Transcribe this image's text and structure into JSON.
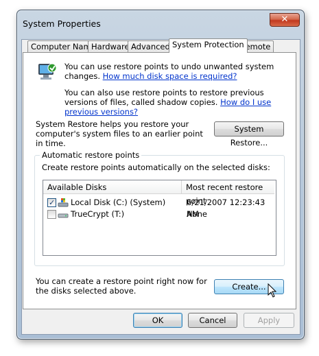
{
  "window": {
    "title": "System Properties",
    "close_glyph": "✕"
  },
  "tabs": [
    {
      "label": "Computer Name"
    },
    {
      "label": "Hardware"
    },
    {
      "label": "Advanced"
    },
    {
      "label": "System Protection"
    },
    {
      "label": "Remote"
    }
  ],
  "intro": {
    "line1": "You can use restore points to undo unwanted system changes.",
    "link1": "How much disk space is required?",
    "line2": "You can also use restore points to restore previous versions of files, called shadow copies.",
    "link2": "How do I use previous versions?"
  },
  "system_restore": {
    "description": "System Restore helps you restore your computer's system files to an earlier point in time.",
    "button_label": "System Restore..."
  },
  "automatic": {
    "group_label": "Automatic restore points",
    "description": "Create restore points automatically on the selected disks:",
    "columns": [
      "Available Disks",
      "Most recent restore point"
    ],
    "disks": [
      {
        "name": "Local Disk (C:) (System)",
        "restore_point": "6/21/2007 12:23:43 AM",
        "checked": true,
        "icon": "system-drive-icon"
      },
      {
        "name": "TrueCrypt (T:)",
        "restore_point": "None",
        "checked": false,
        "icon": "drive-icon"
      }
    ]
  },
  "create": {
    "description": "You can create a restore point right now for the disks selected above.",
    "button_label": "Create..."
  },
  "footer": {
    "ok": "OK",
    "cancel": "Cancel",
    "apply": "Apply"
  },
  "colors": {
    "link": "#0033cc",
    "accent_border": "#3c7fb1",
    "close_red": "#c2391f"
  }
}
